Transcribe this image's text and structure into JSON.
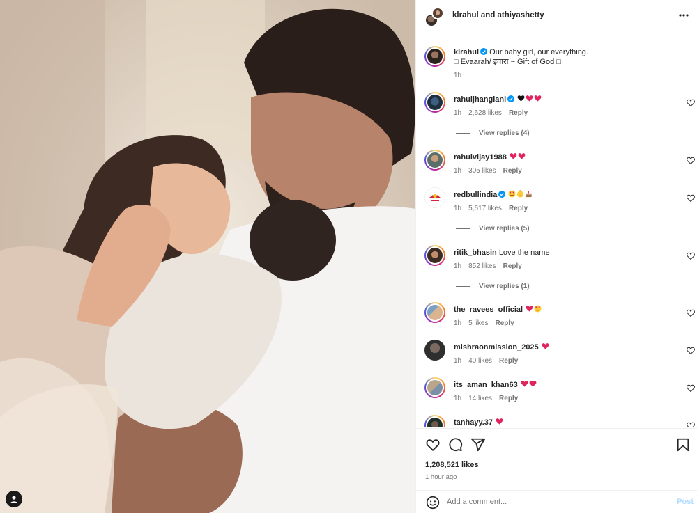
{
  "post": {
    "header_title": "klrahul and athiyashetty",
    "caption": {
      "username": "klrahul",
      "line1": "Our baby girl, our everything.",
      "line2": "□ Evaarah/ इवारा ~ Gift of God □",
      "time": "1h"
    },
    "likes": "1,208,521 likes",
    "time_ago": "1 hour ago"
  },
  "comments": [
    {
      "username": "rahuljhangiani",
      "verified": true,
      "text": "",
      "emojis": [
        "black-heart",
        "red-heart",
        "red-heart"
      ],
      "time": "1h",
      "likes": "2,628 likes",
      "reply": "Reply",
      "view_replies": "View replies (4)"
    },
    {
      "username": "rahulvijay1988",
      "verified": false,
      "text": "",
      "emojis": [
        "red-heart",
        "red-heart"
      ],
      "time": "1h",
      "likes": "305 likes",
      "reply": "Reply",
      "view_replies": ""
    },
    {
      "username": "redbullindia",
      "verified": true,
      "text": "",
      "emojis": [
        "heart-eyes",
        "baby-face",
        "cake"
      ],
      "time": "1h",
      "likes": "5,617 likes",
      "reply": "Reply",
      "view_replies": "View replies (5)"
    },
    {
      "username": "ritik_bhasin",
      "verified": false,
      "text": "Love the name",
      "emojis": [],
      "time": "1h",
      "likes": "852 likes",
      "reply": "Reply",
      "view_replies": "View replies (1)"
    },
    {
      "username": "the_ravees_official",
      "verified": false,
      "text": "",
      "emojis": [
        "red-heart",
        "heart-eyes"
      ],
      "time": "1h",
      "likes": "5 likes",
      "reply": "Reply",
      "view_replies": ""
    },
    {
      "username": "mishraonmission_2025",
      "verified": false,
      "text": "",
      "emojis": [
        "red-heart"
      ],
      "time": "1h",
      "likes": "40 likes",
      "reply": "Reply",
      "view_replies": ""
    },
    {
      "username": "its_aman_khan63",
      "verified": false,
      "text": "",
      "emojis": [
        "red-heart",
        "red-heart"
      ],
      "time": "1h",
      "likes": "14 likes",
      "reply": "Reply",
      "view_replies": ""
    },
    {
      "username": "tanhayy.37",
      "verified": false,
      "text": "",
      "emojis": [
        "red-heart"
      ],
      "time": "",
      "likes": "",
      "reply": "",
      "view_replies": ""
    }
  ],
  "composer": {
    "placeholder": "Add a comment...",
    "post_label": "Post"
  },
  "colors": {
    "link": "#0095f6",
    "heart": "#ff3040",
    "verified": "#0095f6",
    "muted": "#737373"
  },
  "icons": [
    "like-icon",
    "comment-icon",
    "share-icon",
    "save-icon",
    "emoji-icon",
    "more-icon",
    "user-tag-icon"
  ]
}
